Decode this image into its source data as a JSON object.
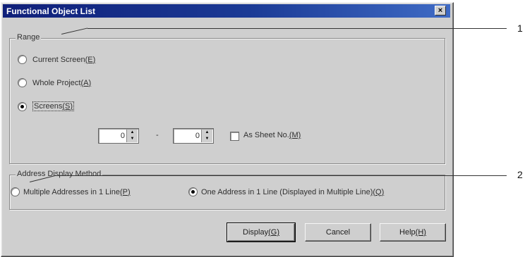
{
  "window": {
    "title": "Functional Object List",
    "close_glyph": "×"
  },
  "range": {
    "title": "Range",
    "options": [
      {
        "label": "Current Screen",
        "shortcut": "(E)",
        "checked": false
      },
      {
        "label": "Whole Project",
        "shortcut": "(A)",
        "checked": false
      },
      {
        "label": "Screens",
        "shortcut": "(S)",
        "checked": true
      }
    ],
    "from_value": "0",
    "separator": "-",
    "to_value": "0",
    "sheet_checkbox": {
      "label": "As Sheet No.",
      "shortcut": "(M)",
      "checked": false
    }
  },
  "address": {
    "title": "Address Display Method",
    "options": [
      {
        "label": "Multiple Addresses in 1 Line",
        "shortcut": "(P)",
        "checked": false
      },
      {
        "label": "One Address in 1 Line (Displayed in Multiple Line)",
        "shortcut": "(Q)",
        "checked": true
      }
    ]
  },
  "buttons": {
    "display": {
      "label": "Display",
      "shortcut": "(G)"
    },
    "cancel": {
      "label": "Cancel"
    },
    "help": {
      "label": "Help",
      "shortcut": "(H)"
    }
  },
  "callouts": [
    "1",
    "2"
  ],
  "icons": {
    "spin_up": "up-arrow-icon",
    "spin_down": "down-arrow-icon",
    "close": "close-icon"
  },
  "colors": {
    "titlebar": "#10207a",
    "dialog_face": "#cfcfcf"
  }
}
